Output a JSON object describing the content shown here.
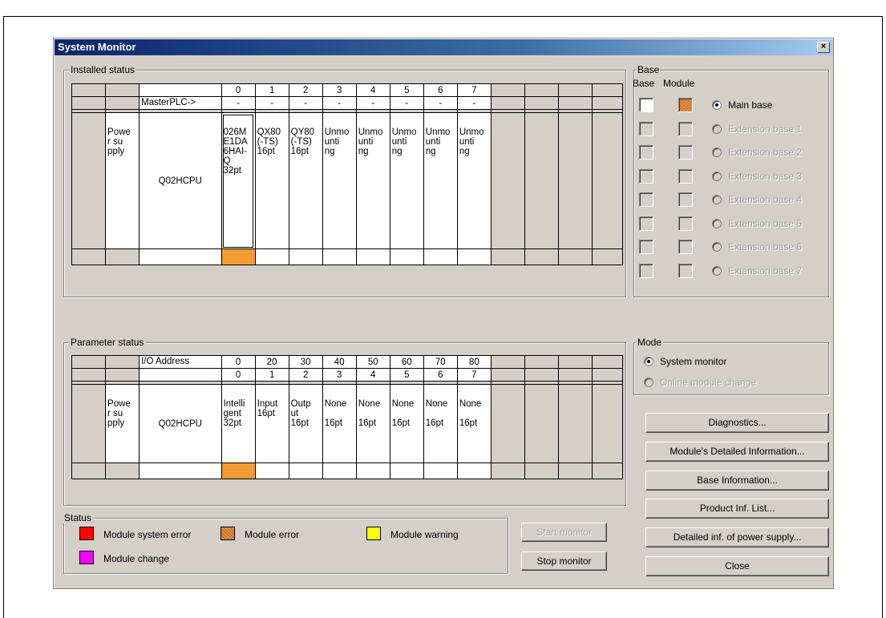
{
  "window": {
    "title": "System Monitor",
    "close_glyph": "×"
  },
  "installed": {
    "label": "Installed status",
    "slot_numbers": [
      "0",
      "1",
      "2",
      "3",
      "4",
      "5",
      "6",
      "7"
    ],
    "master_label": "MasterPLC->",
    "master_values": [
      "-",
      "-",
      "-",
      "-",
      "-",
      "-",
      "-",
      "-"
    ],
    "power_label": "Powe\nr su\npply",
    "cpu": "Q02HCPU",
    "modules": [
      "026M\nE1DA\n6HAI-\nQ\n32pt",
      "QX80\n(-TS)\n16pt",
      "QY80\n(-TS)\n16pt",
      "Unmo\nunti\nng",
      "Unmo\nunti\nng",
      "Unmo\nunti\nng",
      "Unmo\nunti\nng",
      "Unmo\nunti\nng"
    ],
    "status_colors": {
      "error": "#f39c33"
    }
  },
  "base": {
    "label": "Base",
    "col_base": "Base",
    "col_module": "Module",
    "options": [
      {
        "label": "Main base",
        "selected": true,
        "enabled": true
      },
      {
        "label": "Extension base 1",
        "selected": false,
        "enabled": false
      },
      {
        "label": "Extension base 2",
        "selected": false,
        "enabled": false
      },
      {
        "label": "Extension base 3",
        "selected": false,
        "enabled": false
      },
      {
        "label": "Extension base 4",
        "selected": false,
        "enabled": false
      },
      {
        "label": "Extension base 5",
        "selected": false,
        "enabled": false
      },
      {
        "label": "Extension base 6",
        "selected": false,
        "enabled": false
      },
      {
        "label": "Extension base 7",
        "selected": false,
        "enabled": false
      }
    ]
  },
  "parameter": {
    "label": "Parameter status",
    "io_label": "I/O Address",
    "io_values": [
      "0",
      "20",
      "30",
      "40",
      "50",
      "60",
      "70",
      "80"
    ],
    "slot_numbers": [
      "0",
      "1",
      "2",
      "3",
      "4",
      "5",
      "6",
      "7"
    ],
    "power_label": "Powe\nr su\npply",
    "cpu": "Q02HCPU",
    "modules": [
      "Intelli\ngent\n32pt",
      "Input\n16pt",
      "Outp\nut\n16pt",
      "None\n\n16pt",
      "None\n\n16pt",
      "None\n\n16pt",
      "None\n\n16pt",
      "None\n\n16pt"
    ]
  },
  "mode": {
    "label": "Mode",
    "system_monitor": "System monitor",
    "online_change": "Online module change"
  },
  "status": {
    "label": "Status",
    "system_error": "Module system error",
    "module_error": "Module error",
    "module_warning": "Module warning",
    "module_change": "Module change",
    "colors": {
      "system_error": "#ff0000",
      "module_error": "#e38a3c",
      "module_warning": "#ffff00",
      "module_change": "#ff00ff"
    }
  },
  "buttons": {
    "start_monitor": "Start monitor",
    "stop_monitor": "Stop monitor",
    "diagnostics": "Diagnostics...",
    "detailed_info": "Module's Detailed Information...",
    "base_info": "Base Information...",
    "product_list": "Product Inf. List...",
    "power_supply": "Detailed inf. of power supply...",
    "close": "Close"
  }
}
